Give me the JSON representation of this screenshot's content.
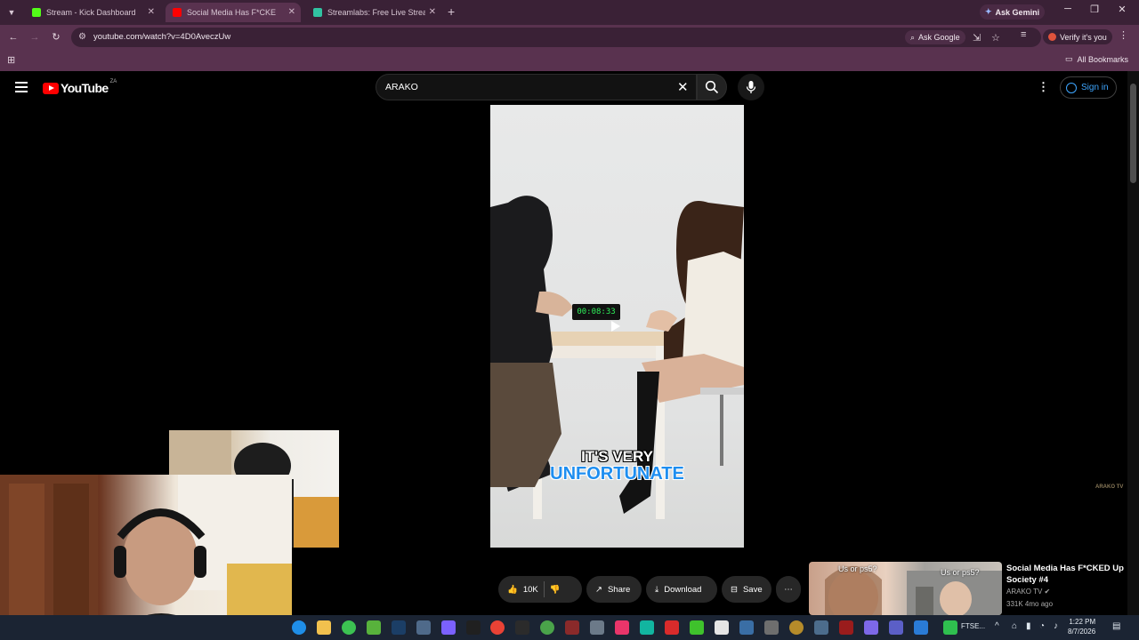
{
  "browser": {
    "tabs": [
      {
        "label": "Stream - Kick Dashboard",
        "favicon_color": "#53fc18"
      },
      {
        "label": "Social Media Has F*CKED Up",
        "favicon_color": "#ff0000"
      },
      {
        "label": "Streamlabs: Free Live Streaming",
        "favicon_color": "#31c3a2"
      }
    ],
    "ask_gemini": "Ask Gemini",
    "url": "youtube.com/watch?v=4D0AveczUw",
    "ask_google": "Ask Google",
    "verify": "Verify it's you",
    "all_bookmarks": "All Bookmarks"
  },
  "youtube": {
    "logo_text": "YouTube",
    "country": "ZA",
    "search_query": "ARAKO",
    "sign_in": "Sign in",
    "video": {
      "timer": "00:08:33",
      "caption_line1": "IT'S VERY",
      "caption_line2": "UNFORTUNATE",
      "watermark": "ARAKO TV"
    },
    "actions": {
      "likes": "10K",
      "share": "Share",
      "download": "Download",
      "save": "Save"
    },
    "suggestion": {
      "thumb_text1": "Us or ps5?",
      "thumb_text2": "Us or ps5?",
      "title": "Social Media Has F*CKED Up Society #4",
      "channel": "ARAKO TV",
      "meta": "331K  4mo ago"
    }
  },
  "taskbar": {
    "time": "1:22 PM",
    "date": "8/7/2026",
    "tray_label": "FTSE..."
  },
  "colors": {
    "tabstrip": "#3a2136",
    "toolbar": "#59324f",
    "youtube_red": "#ff0000",
    "link_blue": "#3ea6ff",
    "caption_blue": "#1e8ef0"
  }
}
